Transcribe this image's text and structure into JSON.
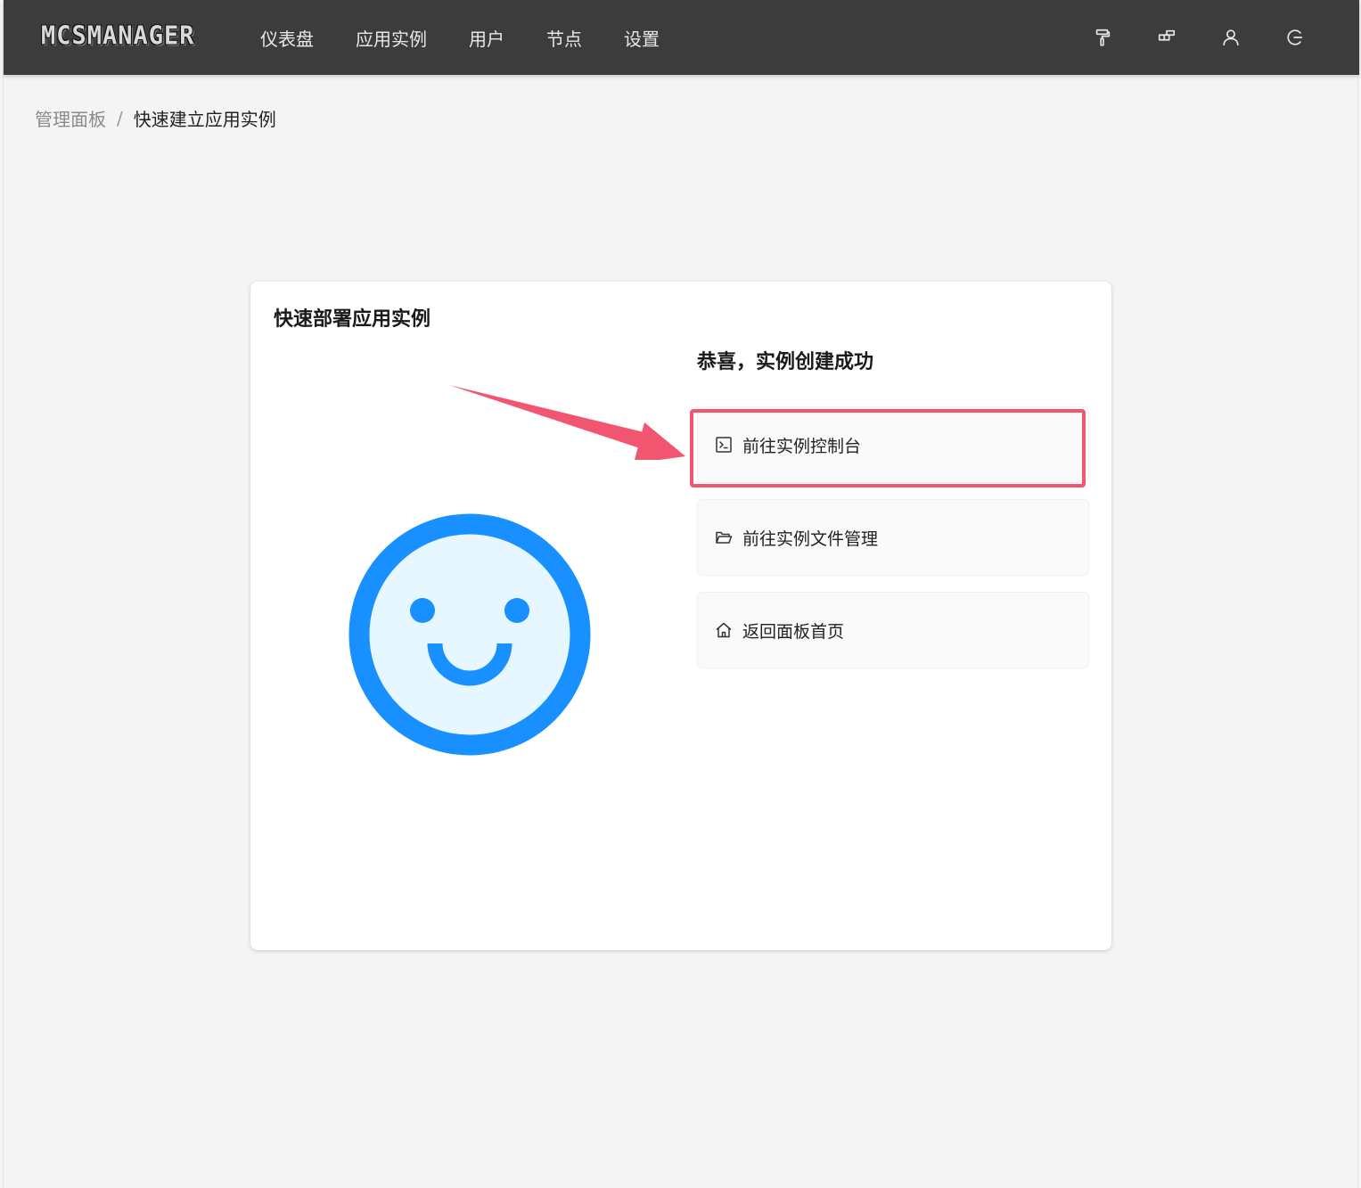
{
  "app": {
    "logo_text": "MCSMANAGER"
  },
  "nav": {
    "items": [
      {
        "id": "dashboard",
        "label": "仪表盘"
      },
      {
        "id": "instances",
        "label": "应用实例"
      },
      {
        "id": "users",
        "label": "用户"
      },
      {
        "id": "nodes",
        "label": "节点"
      },
      {
        "id": "settings",
        "label": "设置"
      }
    ]
  },
  "top_icons": [
    "paint-roller-icon",
    "layout-icon",
    "user-icon",
    "logout-icon"
  ],
  "breadcrumb": {
    "root": "管理面板",
    "separator": "/",
    "current": "快速建立应用实例"
  },
  "card": {
    "title": "快速部署应用实例",
    "success_title": "恭喜，实例创建成功",
    "illustration": "smiley-face-icon",
    "actions": [
      {
        "id": "console",
        "label": "前往实例控制台",
        "icon": "terminal-icon"
      },
      {
        "id": "files",
        "label": "前往实例文件管理",
        "icon": "folder-open-icon"
      },
      {
        "id": "home",
        "label": "返回面板首页",
        "icon": "home-icon"
      }
    ]
  },
  "colors": {
    "topbar": "#3c3c3c",
    "smiley_stroke": "#1890ff",
    "smiley_fill": "#e6f7ff",
    "annotation": "#f25570"
  }
}
